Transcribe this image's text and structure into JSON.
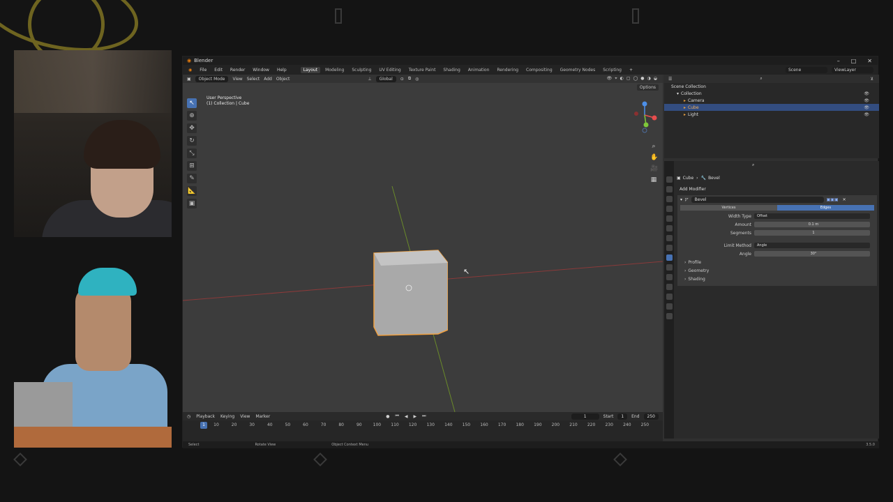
{
  "blender": {
    "app_title": "Blender",
    "menu": [
      "File",
      "Edit",
      "Render",
      "Window",
      "Help"
    ],
    "workspaces": [
      "Layout",
      "Modeling",
      "Sculpting",
      "UV Editing",
      "Texture Paint",
      "Shading",
      "Animation",
      "Rendering",
      "Compositing",
      "Geometry Nodes",
      "Scripting"
    ],
    "active_workspace": "Layout",
    "scene": "Scene",
    "view_layer": "ViewLayer",
    "viewport": {
      "mode": "Object Mode",
      "menus": [
        "View",
        "Select",
        "Add",
        "Object"
      ],
      "orientation": "Global",
      "perspective": "User Perspective",
      "context": "(1) Collection | Cube",
      "options_label": "Options"
    },
    "outliner": {
      "root": "Scene Collection",
      "collection": "Collection",
      "items": [
        "Camera",
        "Cube",
        "Light"
      ],
      "selected": "Cube"
    },
    "properties": {
      "breadcrumb_object": "Cube",
      "breadcrumb_modifier": "Bevel",
      "add_modifier": "Add Modifier",
      "modifier_name": "Bevel",
      "affect_options": [
        "Vertices",
        "Edges"
      ],
      "affect_selected": "Edges",
      "width_type_label": "Width Type",
      "width_type": "Offset",
      "amount_label": "Amount",
      "amount": "0.1 m",
      "segments_label": "Segments",
      "segments": "1",
      "limit_method_label": "Limit Method",
      "limit_method": "Angle",
      "angle_label": "Angle",
      "angle": "30°",
      "panels": [
        "Profile",
        "Geometry",
        "Shading"
      ]
    },
    "timeline": {
      "menus": [
        "Playback",
        "Keying",
        "View",
        "Marker"
      ],
      "current_frame": "1",
      "start_label": "Start",
      "start": "1",
      "end_label": "End",
      "end": "250",
      "ticks": [
        "10",
        "20",
        "30",
        "40",
        "50",
        "60",
        "70",
        "80",
        "90",
        "100",
        "110",
        "120",
        "130",
        "140",
        "150",
        "160",
        "170",
        "180",
        "190",
        "200",
        "210",
        "220",
        "230",
        "240",
        "250"
      ]
    },
    "status": {
      "select": "Select",
      "rotate_view": "Rotate View",
      "context_menu": "Object Context Menu",
      "version": "3.5.0"
    }
  }
}
